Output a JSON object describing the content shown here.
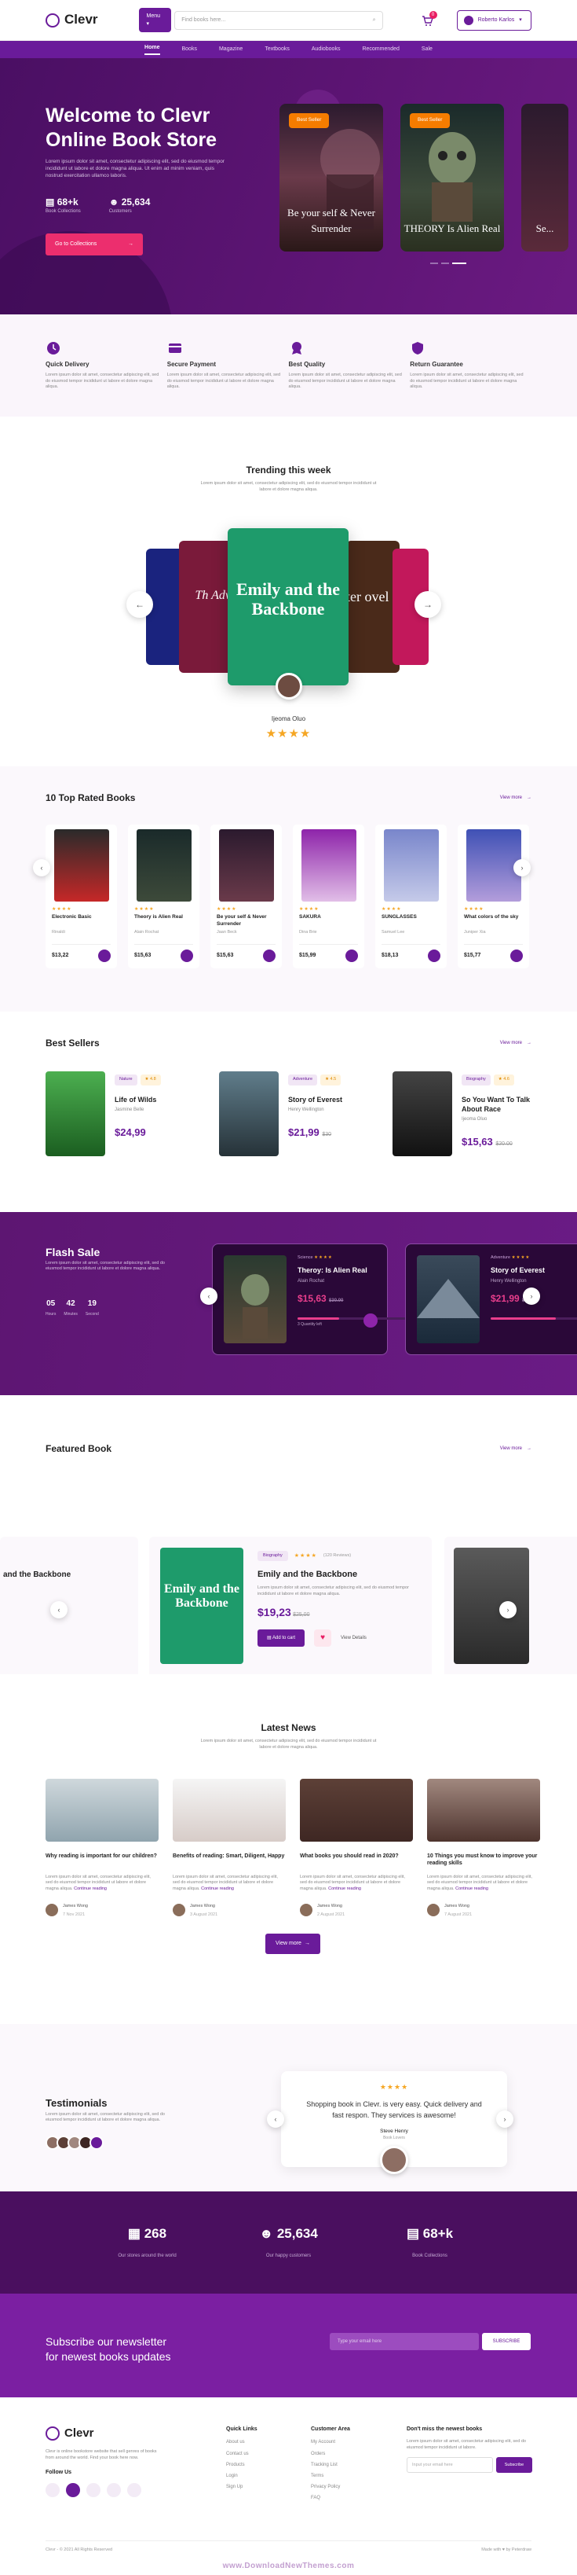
{
  "header": {
    "logo": "Clevr",
    "menu_label": "Menu",
    "search_placeholder": "Find books here...",
    "cart_count": "0",
    "user_name": "Roberto Karlos",
    "nav": [
      "Home",
      "Books",
      "Magazine",
      "Textbooks",
      "Audiobooks",
      "Recommended",
      "Sale"
    ]
  },
  "hero": {
    "title_pre": "Welcome to ",
    "title_brand": "Clevr",
    "title_post": "Online Book Store",
    "desc": "Lorem ipsum dolor sit amet, consectetur adipiscing elit, sed do eiusmod tempor incididunt ut labore et dolore magna aliqua. Ut enim ad minim veniam, quis nostrud exercitation ullamco laboris.",
    "stat1_num": "68+k",
    "stat1_label": "Book Collections",
    "stat2_num": "25,634",
    "stat2_label": "Customers",
    "cta": "Go to Collections",
    "card1_tag": "Best Seller",
    "card1_title": "Be your self & Never Surrender",
    "card2_tag": "Best Seller",
    "card2_title": "THEORY Is Alien Real",
    "card3_title": "Se..."
  },
  "features": [
    {
      "title": "Quick Delivery",
      "desc": "Lorem ipsum dolor sit amet, consectetur adipiscing elit, sed do eiusmod tempor incididunt ut labore et dolore magna aliqua."
    },
    {
      "title": "Secure Payment",
      "desc": "Lorem ipsum dolor sit amet, consectetur adipiscing elit, sed do eiusmod tempor incididunt ut labore et dolore magna aliqua."
    },
    {
      "title": "Best Quality",
      "desc": "Lorem ipsum dolor sit amet, consectetur adipiscing elit, sed do eiusmod tempor incididunt ut labore et dolore magna aliqua."
    },
    {
      "title": "Return Guarantee",
      "desc": "Lorem ipsum dolor sit amet, consectetur adipiscing elit, sed do eiusmod tempor incididunt ut labore et dolore magna aliqua."
    }
  ],
  "trending": {
    "title": "Trending this week",
    "desc": "Lorem ipsum dolor sit amet, consectetur adipiscing elit, sed do eiusmod tempor incididunt ut labore et dolore magna aliqua.",
    "main_title": "Emily and the Backbone",
    "left2": "Th Adv",
    "right2": "ter ovel",
    "author": "Ijeoma Oluo",
    "stars": "★★★★"
  },
  "top_rated": {
    "title": "10 Top Rated Books",
    "view_more": "View more",
    "books": [
      {
        "name": "Electronic Basic",
        "author": "Rinaldi",
        "price": "$13,22",
        "stars": "★★★★"
      },
      {
        "name": "Theory is Alien Real",
        "author": "Alain Rochat",
        "price": "$15,63",
        "stars": "★★★★"
      },
      {
        "name": "Be your self & Never Surrender",
        "author": "Jaan Beck",
        "price": "$15,63",
        "stars": "★★★★"
      },
      {
        "name": "SAKURA",
        "author": "Dina Brie",
        "price": "$15,99",
        "stars": "★★★★"
      },
      {
        "name": "SUNGLASSES",
        "author": "Samuel Lee",
        "price": "$18,13",
        "stars": "★★★★"
      },
      {
        "name": "What colors of the sky",
        "author": "Juniper Xia",
        "price": "$15,77",
        "stars": "★★★★"
      }
    ]
  },
  "best_sellers": {
    "title": "Best Sellers",
    "view_more": "View more",
    "books": [
      {
        "tag1": "Nature",
        "tag2": "4.8",
        "name": "Life of Wilds",
        "author": "Jasmine Belle",
        "price": "$24,99"
      },
      {
        "tag1": "Adventure",
        "tag2": "4.5",
        "name": "Story of Everest",
        "author": "Henry Wellington",
        "price": "$21,99",
        "old": "$30"
      },
      {
        "tag1": "Biography",
        "tag2": "4.6",
        "name": "So You Want To Talk About Race",
        "author": "Ijeoma Oluo",
        "price": "$15,63",
        "old": "$20.00"
      }
    ]
  },
  "flash": {
    "title": "Flash Sale",
    "desc": "Lorem ipsum dolor sit amet, consectetur adipiscing elit, sed do eiusmod tempor incididunt ut labore et dolore magna aliqua.",
    "timer": [
      {
        "v": "05",
        "l": "Hours"
      },
      {
        "v": "42",
        "l": "Minutes"
      },
      {
        "v": "19",
        "l": "Second"
      }
    ],
    "card1": {
      "tag": "Science",
      "name": "Theroy: Is Alien Real",
      "author": "Alain Rochat",
      "price": "$15,63",
      "old": "$30.00",
      "sold": "3 Quantity left",
      "pct": 0.35
    },
    "card2": {
      "tag": "Adventure",
      "name": "Story of Everest",
      "author": "Henry Wellington",
      "price": "$21,99",
      "old": "$30.00",
      "pct": 0.55
    }
  },
  "featured": {
    "title": "Featured Book",
    "view_more": "View more",
    "left_name": "and the Backbone",
    "tag": "Biography",
    "reviews": "(120 Reviews)",
    "name": "Emily and the Backbone",
    "desc": "Lorem ipsum dolor sit amet, consectetur adipiscing elit, sed do eiusmod tempor incididunt ut labore et dolore magna aliqua.",
    "price": "$19,23",
    "old": "$25,00",
    "add": "Add to cart",
    "details": "View Details"
  },
  "news": {
    "title": "Latest News",
    "desc": "Lorem ipsum dolor sit amet, consectetur adipiscing elit, sed do eiusmod tempor incididunt ut labore et dolore magna aliqua.",
    "items": [
      {
        "t": "Why reading is important for our children?",
        "author": "James Wong",
        "date": "7 Nov 2021"
      },
      {
        "t": "Benefits of reading: Smart, Diligent, Happy",
        "author": "James Wong",
        "date": "3 August 2021"
      },
      {
        "t": "What books you should read in 2020?",
        "author": "James Wong",
        "date": "2 August 2021"
      },
      {
        "t": "10 Things you must know to improve your reading skills",
        "author": "James Wong",
        "date": "7 August 2021"
      }
    ],
    "more": "Continue reading",
    "view_more": "View more"
  },
  "testimonials": {
    "title": "Testimonials",
    "desc": "Lorem ipsum dolor sit amet, consectetur adipiscing elit, sed do eiusmod tempor incididunt ut labore et dolore magna aliqua.",
    "quote": "Shopping book in Clevr. is very easy. Quick delivery and fast respon. They services is awesome!",
    "name": "Steve Henry",
    "role": "Book Lovers"
  },
  "counter": [
    {
      "n": "268",
      "l": "Our stores around the world"
    },
    {
      "n": "25,634",
      "l": "Our happy customers"
    },
    {
      "n": "68+k",
      "l": "Book Collections"
    }
  ],
  "newsletter": {
    "title1": "Subscribe our newsletter",
    "title2": "for newest books updates",
    "placeholder": "Type your email here",
    "btn": "SUBSCRIBE"
  },
  "footer": {
    "logo": "Clevr",
    "desc": "Clevr is online bookstore website that sell genres of books from around the world. Find your book here now.",
    "follow": "Follow Us",
    "col1_h": "Quick Links",
    "col1": [
      "About us",
      "Contact us",
      "Products",
      "Login",
      "Sign Up"
    ],
    "col2_h": "Customer Area",
    "col2": [
      "My Account",
      "Orders",
      "Tracking List",
      "Terms",
      "Privacy Policy",
      "FAQ"
    ],
    "col3_h": "Don't miss the newest books",
    "col3_desc": "Lorem ipsum dolor sit amet, consectetur adipiscing elit, sed do eiusmod tempor incididunt ut labore.",
    "email_placeholder": "Input your email here",
    "sub": "Subscribe",
    "copy": "Clevr - © 2021 All Rights Reserved",
    "made": "Made with ♥ by Peterdraw"
  },
  "watermark": "www.DownloadNewThemes.com"
}
